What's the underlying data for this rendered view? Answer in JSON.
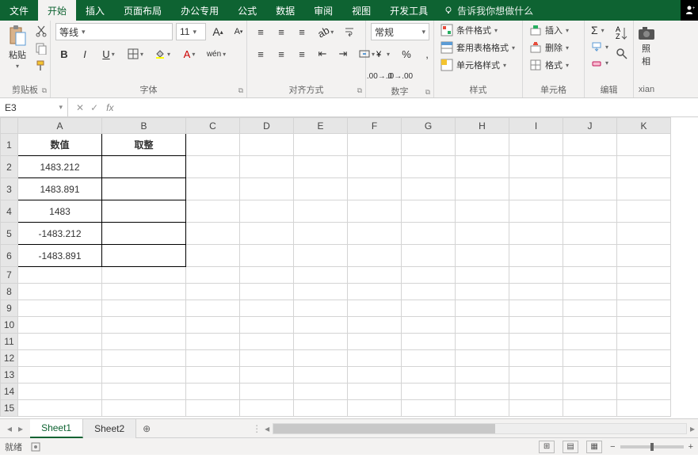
{
  "menu": {
    "file": "文件",
    "home": "开始",
    "insert": "插入",
    "layout": "页面布局",
    "office": "办公专用",
    "formula": "公式",
    "data": "数据",
    "review": "审阅",
    "view": "视图",
    "dev": "开发工具",
    "tell": "告诉我你想做什么"
  },
  "ribbon": {
    "clipboard": {
      "paste": "粘贴",
      "label": "剪贴板"
    },
    "font": {
      "name": "等线",
      "size": "11",
      "label": "字体"
    },
    "align": {
      "label": "对齐方式"
    },
    "number": {
      "general": "常规",
      "label": "数字"
    },
    "styles": {
      "cond": "条件格式",
      "table": "套用表格格式",
      "cell": "单元格样式",
      "label": "样式"
    },
    "cells": {
      "insert": "插入",
      "delete": "删除",
      "format": "格式",
      "label": "单元格"
    },
    "editing": {
      "label": "编辑"
    },
    "camera": {
      "label": "照相",
      "cut": "xian"
    }
  },
  "namebox": {
    "ref": "E3",
    "formula": ""
  },
  "cols": [
    "A",
    "B",
    "C",
    "D",
    "E",
    "F",
    "G",
    "H",
    "I",
    "J",
    "K"
  ],
  "rows": [
    "1",
    "2",
    "3",
    "4",
    "5",
    "6",
    "7",
    "8",
    "9",
    "10",
    "11",
    "12",
    "13",
    "14",
    "15"
  ],
  "headers": {
    "a": "数值",
    "b": "取整"
  },
  "data": {
    "a2": "1483.212",
    "a3": "1483.891",
    "a4": "1483",
    "a5": "-1483.212",
    "a6": "-1483.891"
  },
  "sheets": {
    "s1": "Sheet1",
    "s2": "Sheet2"
  },
  "status": {
    "ready": "就绪"
  }
}
